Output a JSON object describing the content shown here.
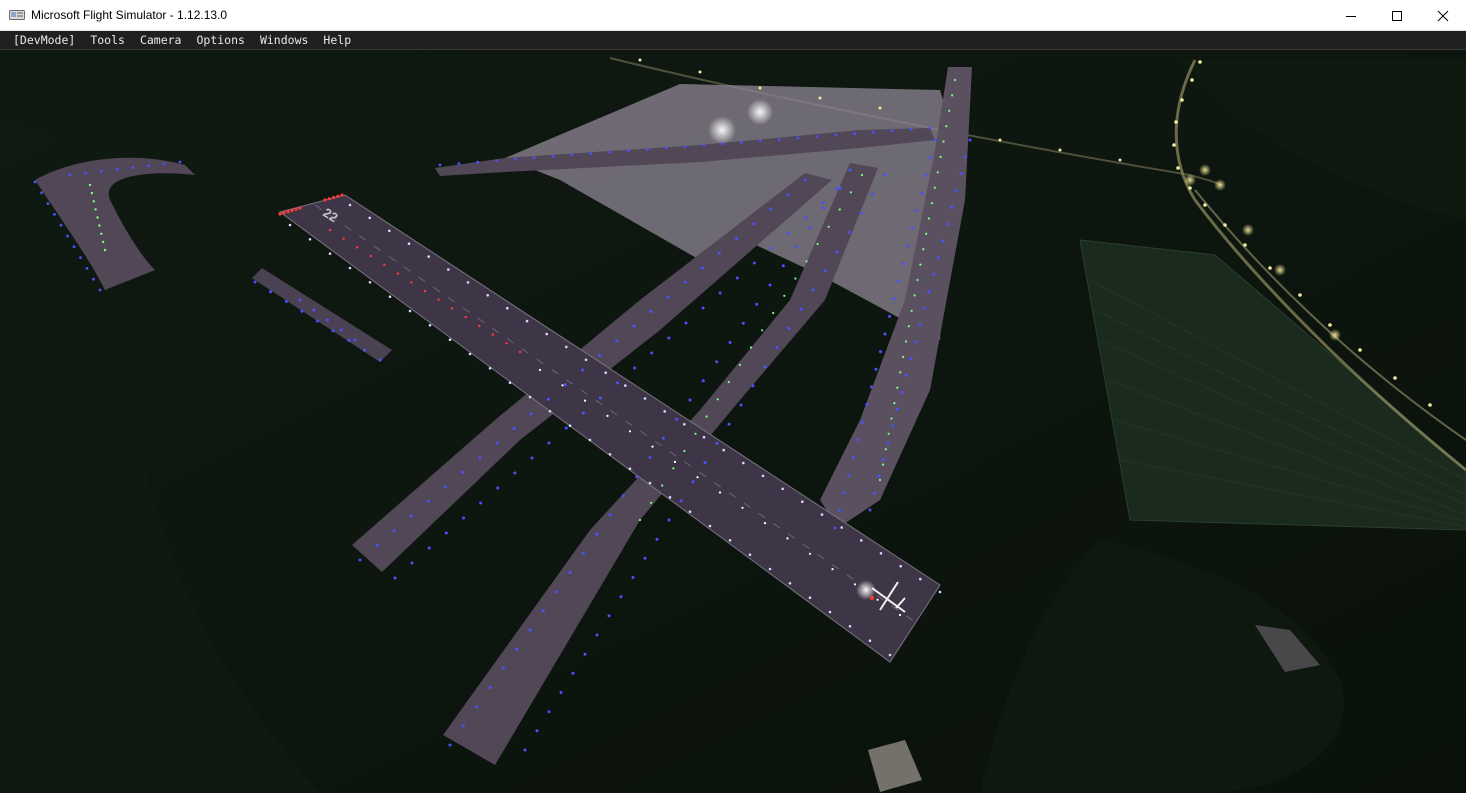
{
  "window": {
    "title": "Microsoft Flight Simulator - 1.12.13.0",
    "controls": {
      "minimize": "minimize-icon",
      "maximize": "maximize-icon",
      "close": "close-icon"
    }
  },
  "menubar": {
    "items": [
      "[DevMode]",
      "Tools",
      "Camera",
      "Options",
      "Windows",
      "Help"
    ]
  },
  "scene": {
    "runway_number": "22",
    "colors": {
      "ground": "#0b100c",
      "asphalt": "#514757",
      "apron": "#8a8190",
      "edge_light": "#4a52ff",
      "center_light": "#7dff8a",
      "red_light": "#ff3a3a",
      "street_light": "#f3e9a0"
    }
  }
}
